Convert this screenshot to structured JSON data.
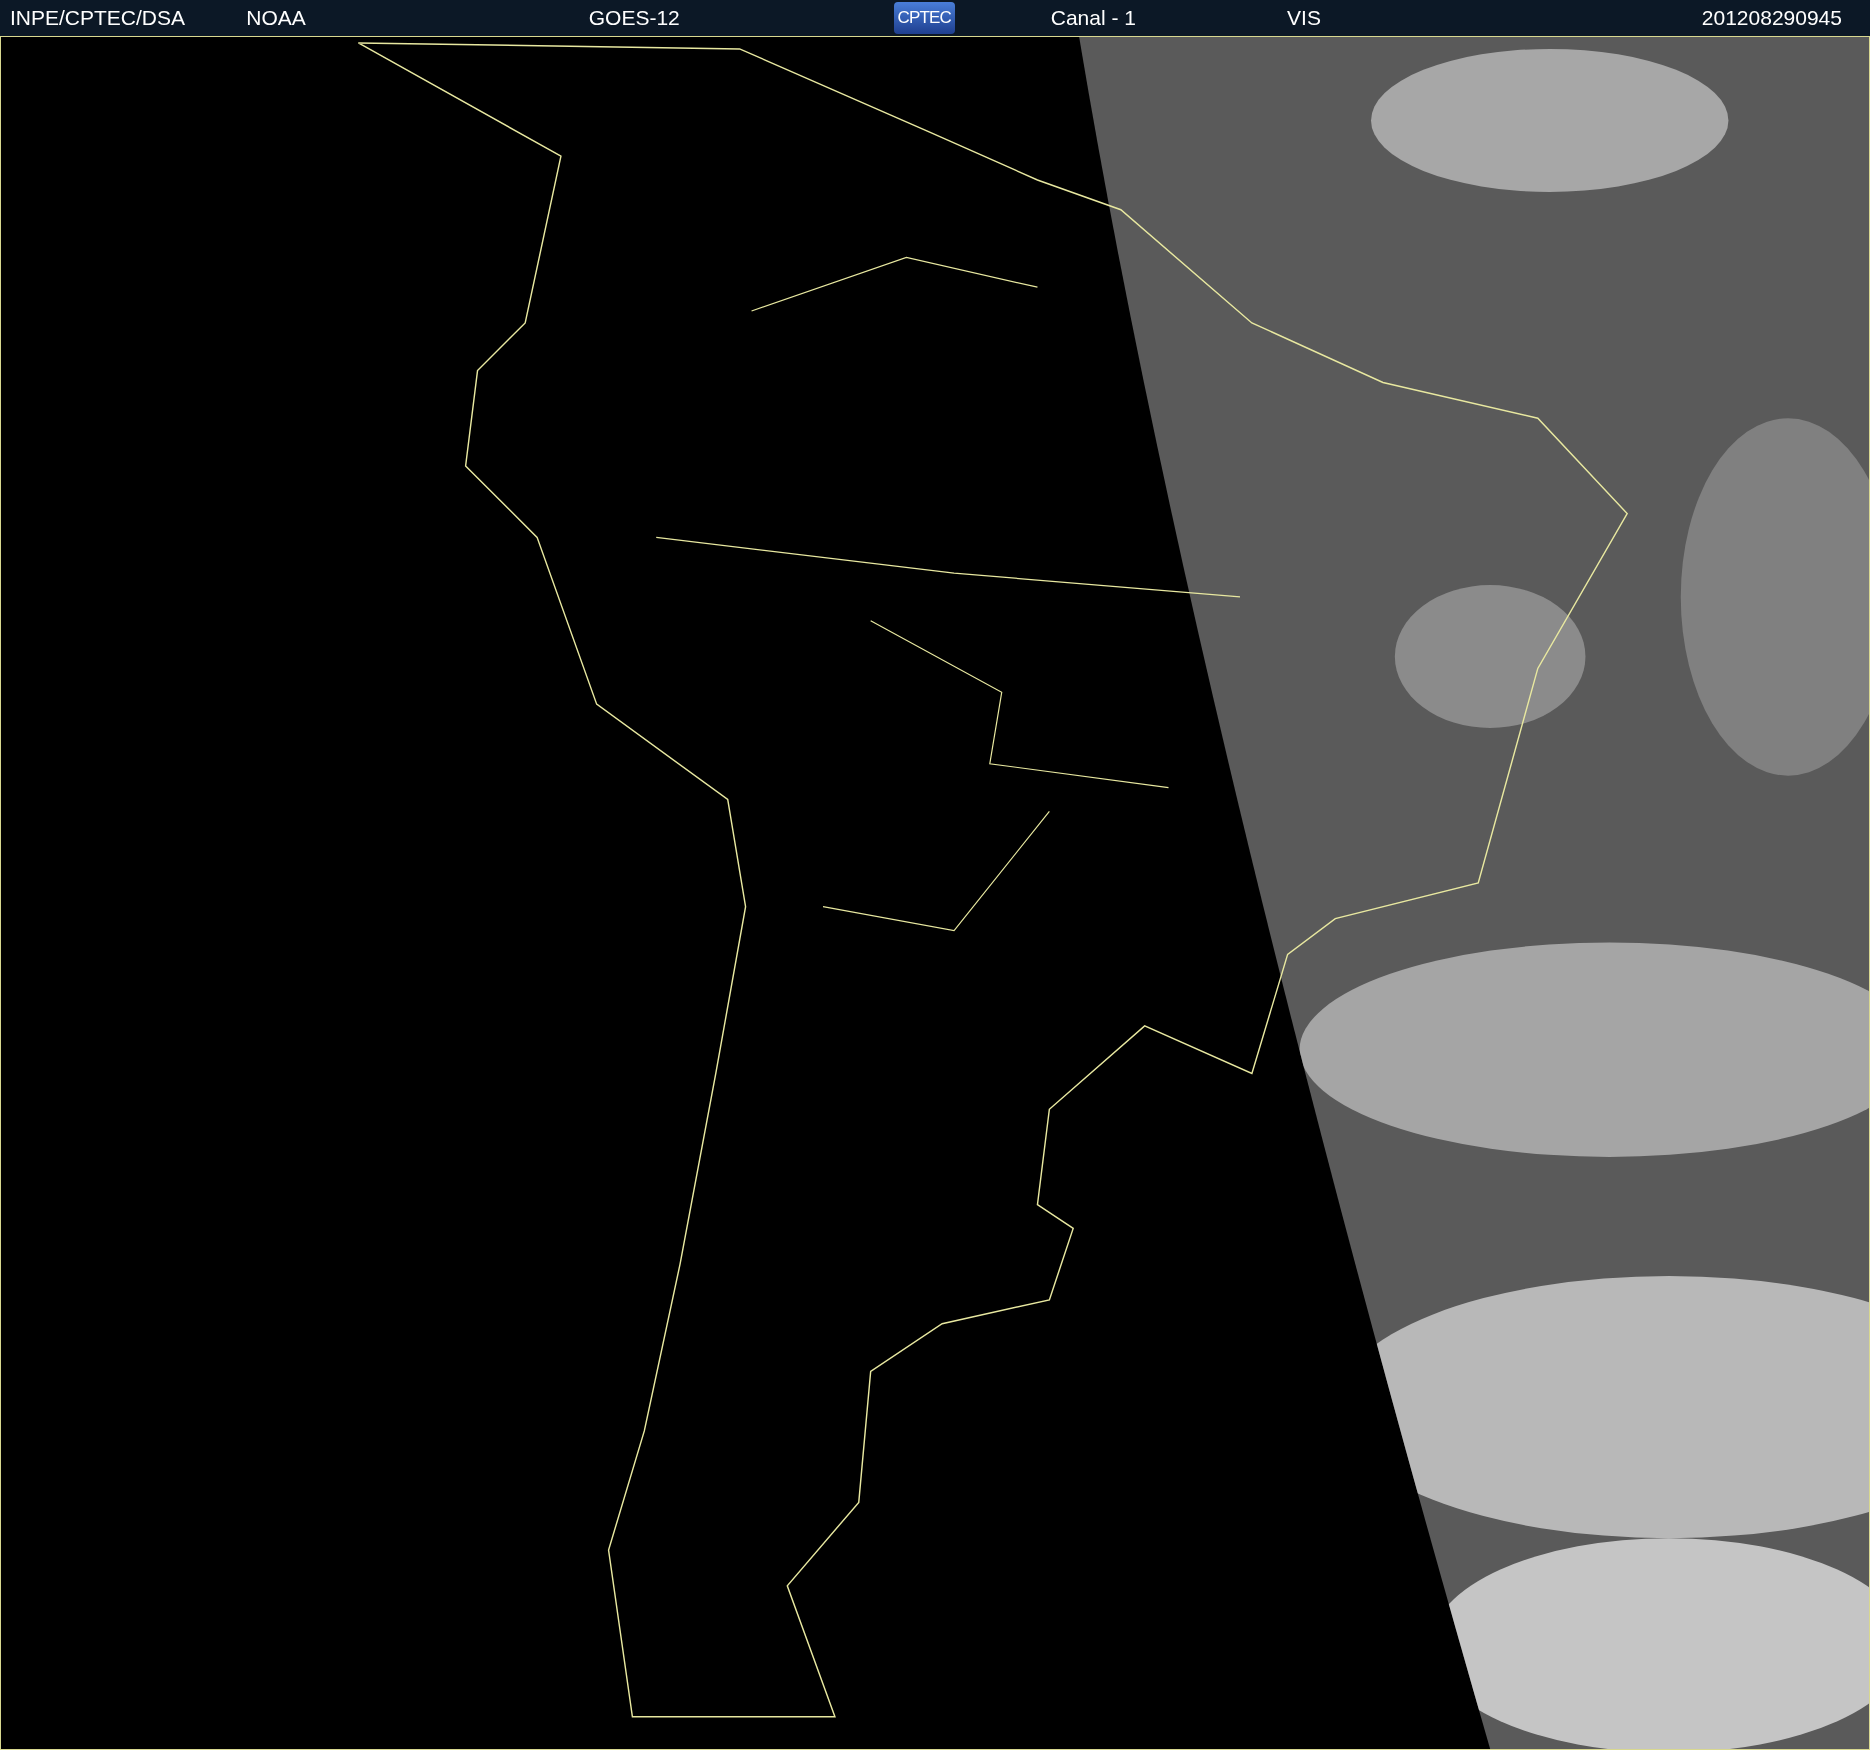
{
  "header": {
    "items": [
      {
        "kind": "text",
        "text": "INPE/CPTEC/DSA"
      },
      {
        "kind": "text",
        "text": "NOAA"
      },
      {
        "kind": "text",
        "text": "GOES-12"
      },
      {
        "kind": "logo",
        "text": "CPTEC"
      },
      {
        "kind": "text",
        "text": "Canal - 1"
      },
      {
        "kind": "text",
        "text": "VIS"
      },
      {
        "kind": "text",
        "text": "201208290945"
      }
    ]
  }
}
